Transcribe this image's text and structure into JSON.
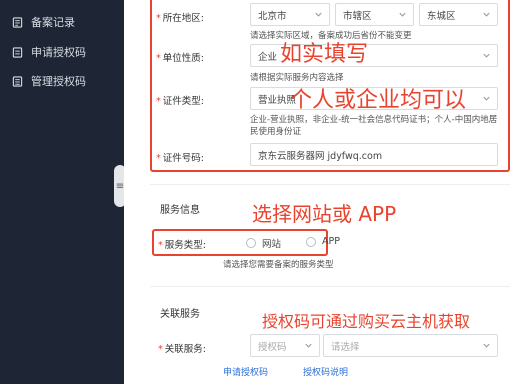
{
  "sidebar": {
    "items": [
      {
        "label": "备案记录",
        "icon": "record-icon"
      },
      {
        "label": "申请授权码",
        "icon": "apply-icon"
      },
      {
        "label": "管理授权码",
        "icon": "manage-icon"
      }
    ]
  },
  "form": {
    "region": {
      "label": "所在地区:",
      "province": "北京市",
      "city": "市辖区",
      "district": "东城区",
      "hint": "请选择实际区域，备案成功后省份不能变更"
    },
    "org_type": {
      "label": "单位性质:",
      "value": "企业",
      "hint": "请根据实际服务内容选择"
    },
    "cert_type": {
      "label": "证件类型:",
      "value": "营业执照",
      "hint": "企业-营业执照，非企业-统一社会信息代码证书；个人-中国内地居民使用身份证"
    },
    "cert_no": {
      "label": "证件号码:",
      "value": "京东云服务器网 jdyfwq.com"
    }
  },
  "service_info": {
    "title": "服务信息",
    "type_label": "服务类型:",
    "options": [
      "网站",
      "APP"
    ],
    "hint": "请选择您需要备案的服务类型"
  },
  "related": {
    "title": "关联服务",
    "label": "关联服务:",
    "select1_placeholder": "授权码",
    "select2_placeholder": "请选择",
    "link_apply": "申请授权码",
    "link_help": "授权码说明"
  },
  "annotations": {
    "a1": "如实填写",
    "a2": "个人或企业均可以",
    "a3": "选择网站或 APP",
    "a4": "授权码可通过购买云主机获取"
  },
  "colors": {
    "sidebar_bg": "#1e2635",
    "accent_red": "#e8432e",
    "link_blue": "#2b6fd6"
  }
}
